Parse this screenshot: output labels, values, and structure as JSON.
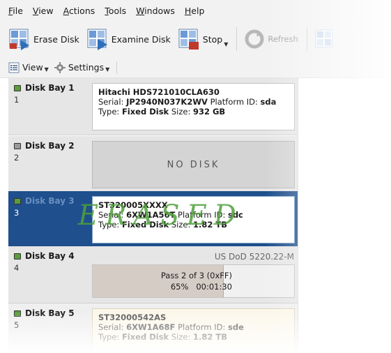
{
  "menu": [
    "File",
    "View",
    "Actions",
    "Tools",
    "Windows",
    "Help"
  ],
  "toolbar": {
    "erase_label": "Erase Disk",
    "examine_label": "Examine Disk",
    "stop_label": "Stop",
    "refresh_label": "Refresh"
  },
  "subtoolbar": {
    "view_label": "View",
    "settings_label": "Settings"
  },
  "bays": [
    {
      "title": "Disk Bay 1",
      "num": "1",
      "model": "Hitachi HDS721010CLA630",
      "serial_label": "Serial:",
      "serial": "JP2940N037K2WV",
      "platform_label": "Platform ID:",
      "platform": "sda",
      "type_label": "Type:",
      "type": "Fixed Disk",
      "size_label": "Size:",
      "size": "932 GB"
    },
    {
      "title": "Disk Bay 2",
      "num": "2",
      "nodisk": "NO DISK"
    },
    {
      "title": "Disk Bay 3",
      "num": "3",
      "model": "ST320005XXXX",
      "serial_label": "Serial:",
      "serial": "6XW1A56T",
      "platform_label": "Platform ID:",
      "platform": "sdc",
      "type_label": "Type:",
      "type": "Fixed Disk",
      "size_label": "Size:",
      "size": "1.82 TB",
      "stamp": "ERASED"
    },
    {
      "title": "Disk Bay 4",
      "num": "4",
      "method": "US DoD 5220.22-M",
      "pass_text": "Pass 2 of 3 (0xFF)",
      "percent_text": "65%",
      "elapsed": "00:01:30",
      "progress": 0.65
    },
    {
      "title": "Disk Bay 5",
      "num": "5",
      "model": "ST32000542AS",
      "serial_label": "Serial:",
      "serial": "6XW1A68F",
      "platform_label": "Platform ID:",
      "platform": "sde",
      "type_label": "Type:",
      "type": "Fixed Disk",
      "size_label": "Size:",
      "size": "1.82 TB"
    }
  ],
  "colors": {
    "selected": "#1f4f8c",
    "led_active": "#5a9e3a",
    "erased_stamp": "#50a03c"
  }
}
